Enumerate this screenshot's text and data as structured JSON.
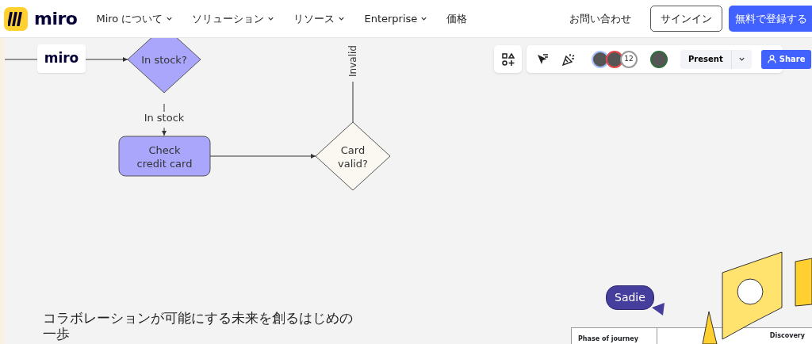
{
  "nav": {
    "logo": "miro",
    "items": [
      {
        "label": "Miro について",
        "dropdown": true
      },
      {
        "label": "ソリューション",
        "dropdown": true
      },
      {
        "label": "リソース",
        "dropdown": true
      },
      {
        "label": "Enterprise",
        "dropdown": true
      },
      {
        "label": "価格",
        "dropdown": false
      }
    ],
    "contact": "お問い合わせ",
    "signin": "サインイン",
    "signup": "無料で登録する"
  },
  "board": {
    "toolbar": {
      "avatars": [
        {
          "color": "#a9c1ff"
        },
        {
          "color": "#e5484d"
        }
      ],
      "avatar_count": "12",
      "presenter": {
        "color": "#2e6b3a"
      },
      "present": "Present",
      "share": "Share"
    },
    "diagram": {
      "logo": "miro",
      "nodes": [
        {
          "kind": "decision",
          "label": "In stock?",
          "color": "#aaa6fb"
        },
        {
          "kind": "process",
          "label": "Check\ncredit card",
          "color": "#aaa6fb"
        },
        {
          "kind": "decision",
          "label": "Card\nvalid?",
          "color": "#fbf8f1"
        }
      ],
      "edge_labels": [
        "In stock",
        "Invalid"
      ]
    },
    "sticker": "Sadie",
    "journey_table": {
      "row_header": "Phase of journey",
      "column": "Discovery"
    },
    "headline": "コラボレーションが可能にする未来を創るはじめの一歩"
  }
}
